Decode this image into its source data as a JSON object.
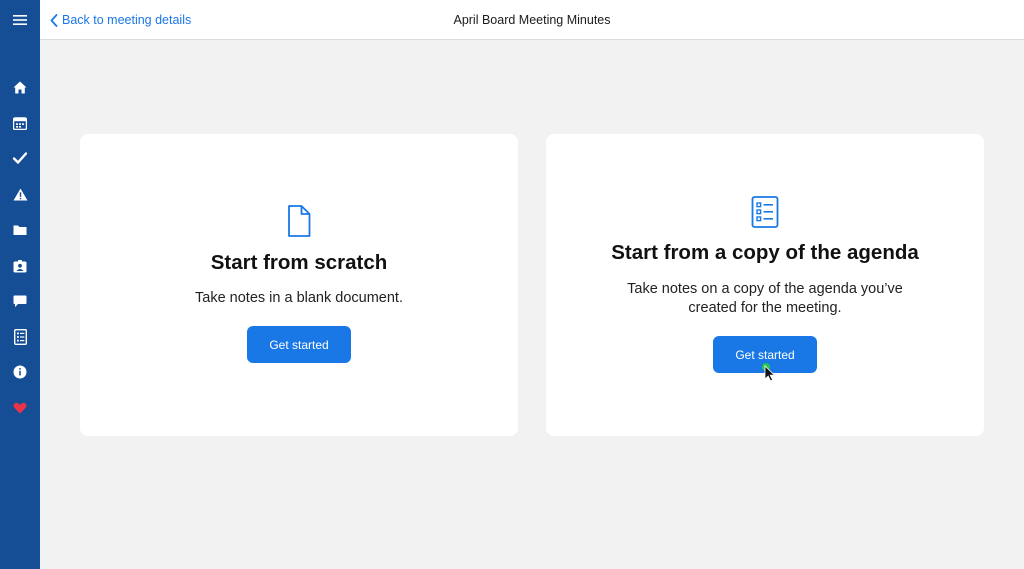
{
  "header": {
    "back_label": "Back to meeting details",
    "title": "April Board Meeting Minutes"
  },
  "sidebar": {
    "items": [
      {
        "icon": "menu-icon"
      },
      {
        "icon": "home-icon"
      },
      {
        "icon": "calendar-icon"
      },
      {
        "icon": "checkmark-icon"
      },
      {
        "icon": "warning-icon"
      },
      {
        "icon": "folder-icon"
      },
      {
        "icon": "contact-card-icon"
      },
      {
        "icon": "chat-bubble-icon"
      },
      {
        "icon": "checklist-icon"
      },
      {
        "icon": "info-icon"
      },
      {
        "icon": "heart-icon"
      }
    ]
  },
  "options": [
    {
      "icon": "blank-document-icon",
      "title": "Start from scratch",
      "description": "Take notes in a blank document.",
      "button_label": "Get started"
    },
    {
      "icon": "agenda-list-icon",
      "title": "Start from a copy of the agenda",
      "description": "Take notes on a copy of the agenda you’ve created for the meeting.",
      "button_label": "Get started"
    }
  ],
  "colors": {
    "sidebar": "#164e96",
    "accent": "#1a78e6",
    "background": "#f2f2f3",
    "favorite": "#e8334a"
  }
}
